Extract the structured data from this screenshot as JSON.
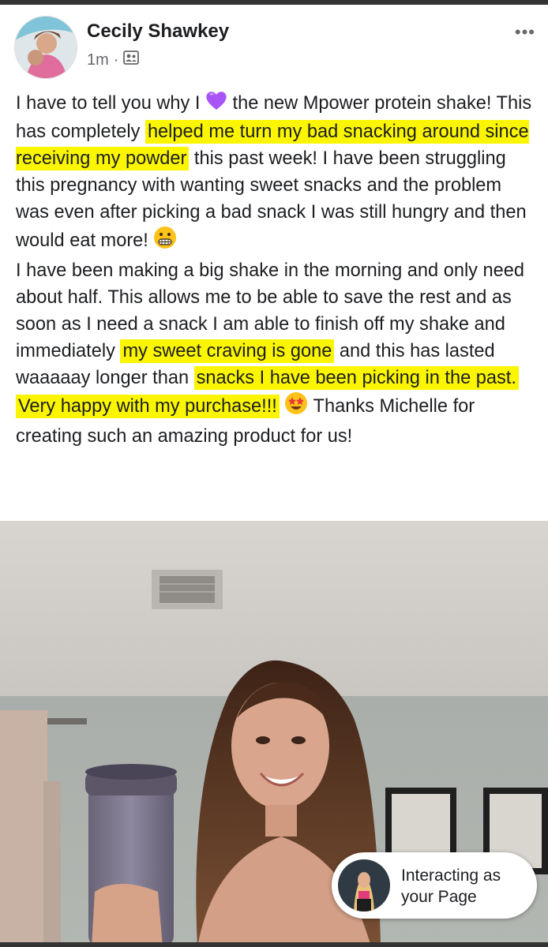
{
  "post": {
    "author": "Cecily Shawkey",
    "time": "1m",
    "separator": "·",
    "audience_icon": "group-audience-icon",
    "more_icon": "more-options-icon",
    "more_label": "•••",
    "text_segments": [
      {
        "id": "s1",
        "text": "I have to tell you why I ",
        "highlight": false
      },
      {
        "id": "s2",
        "text": " the new Mpower protein shake! This has completely ",
        "highlight": false
      },
      {
        "id": "s3",
        "text": "helped me turn my bad snacking around since receiving my powder",
        "highlight": true
      },
      {
        "id": "s4",
        "text": " this past week! I have been struggling this pregnancy with wanting sweet snacks and the problem was even after picking a bad snack I was still hungry and then would eat more! ",
        "highlight": false
      },
      {
        "id": "s5",
        "text": "I have been making a big shake in the morning and only need about half. This allows me to be able to save the rest and as soon as I need a snack I am able to finish off my shake and immediately ",
        "highlight": false
      },
      {
        "id": "s6",
        "text": "my sweet craving is gone",
        "highlight": true
      },
      {
        "id": "s7",
        "text": " and this has lasted waaaaay longer than ",
        "highlight": false
      },
      {
        "id": "s8",
        "text": "snacks I have been picking in the past.",
        "highlight": true
      },
      {
        "id": "s9",
        "text": "Very happy with my purchase!!!",
        "highlight": true
      },
      {
        "id": "s10",
        "text": " Thanks Michelle for creating such an amazing product for us!",
        "highlight": false
      }
    ],
    "emojis": [
      "purple-heart-emoji",
      "grimacing-face-emoji",
      "star-struck-emoji"
    ],
    "highlight_color": "#fbf600"
  },
  "interacting_badge": {
    "line1": "Interacting as",
    "line2": "your Page"
  }
}
